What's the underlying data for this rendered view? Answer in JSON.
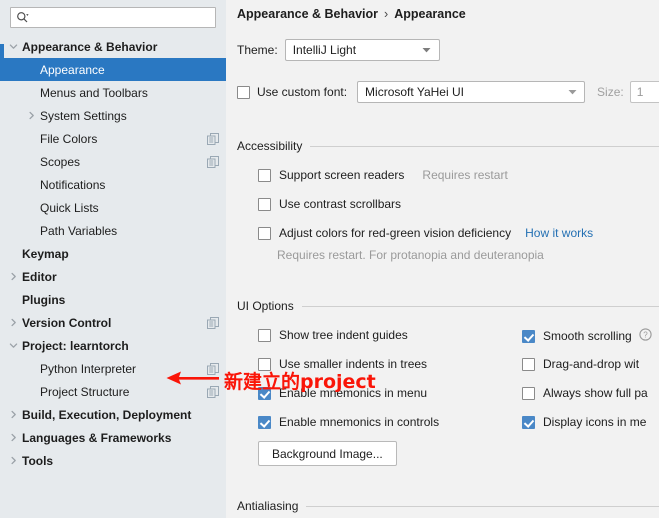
{
  "search": {
    "placeholder": "",
    "value": "",
    "icon": "search-icon"
  },
  "sidebar": {
    "items": [
      {
        "label": "Appearance & Behavior",
        "depth": 0,
        "bold": true,
        "twisty": "chevron-down",
        "selected": false,
        "copy": false
      },
      {
        "label": "Appearance",
        "depth": 1,
        "bold": false,
        "twisty": "none",
        "selected": true,
        "copy": false
      },
      {
        "label": "Menus and Toolbars",
        "depth": 1,
        "bold": false,
        "twisty": "none",
        "selected": false,
        "copy": false
      },
      {
        "label": "System Settings",
        "depth": 1,
        "bold": false,
        "twisty": "chevron-right",
        "selected": false,
        "copy": false
      },
      {
        "label": "File Colors",
        "depth": 1,
        "bold": false,
        "twisty": "none",
        "selected": false,
        "copy": true
      },
      {
        "label": "Scopes",
        "depth": 1,
        "bold": false,
        "twisty": "none",
        "selected": false,
        "copy": true
      },
      {
        "label": "Notifications",
        "depth": 1,
        "bold": false,
        "twisty": "none",
        "selected": false,
        "copy": false
      },
      {
        "label": "Quick Lists",
        "depth": 1,
        "bold": false,
        "twisty": "none",
        "selected": false,
        "copy": false
      },
      {
        "label": "Path Variables",
        "depth": 1,
        "bold": false,
        "twisty": "none",
        "selected": false,
        "copy": false
      },
      {
        "label": "Keymap",
        "depth": 0,
        "bold": true,
        "twisty": "none",
        "selected": false,
        "copy": false
      },
      {
        "label": "Editor",
        "depth": 0,
        "bold": true,
        "twisty": "chevron-right",
        "selected": false,
        "copy": false
      },
      {
        "label": "Plugins",
        "depth": 0,
        "bold": true,
        "twisty": "none",
        "selected": false,
        "copy": false
      },
      {
        "label": "Version Control",
        "depth": 0,
        "bold": true,
        "twisty": "chevron-right",
        "selected": false,
        "copy": true
      },
      {
        "label": "Project: learntorch",
        "depth": 0,
        "bold": true,
        "twisty": "chevron-down",
        "selected": false,
        "copy": false
      },
      {
        "label": "Python Interpreter",
        "depth": 1,
        "bold": false,
        "twisty": "none",
        "selected": false,
        "copy": true
      },
      {
        "label": "Project Structure",
        "depth": 1,
        "bold": false,
        "twisty": "none",
        "selected": false,
        "copy": true
      },
      {
        "label": "Build, Execution, Deployment",
        "depth": 0,
        "bold": true,
        "twisty": "chevron-right",
        "selected": false,
        "copy": false
      },
      {
        "label": "Languages & Frameworks",
        "depth": 0,
        "bold": true,
        "twisty": "chevron-right",
        "selected": false,
        "copy": false
      },
      {
        "label": "Tools",
        "depth": 0,
        "bold": true,
        "twisty": "chevron-right",
        "selected": false,
        "copy": false
      }
    ]
  },
  "breadcrumb": {
    "parent": "Appearance & Behavior",
    "separator": "›",
    "current": "Appearance"
  },
  "theme": {
    "label": "Theme:",
    "value": "IntelliJ Light"
  },
  "custom_font": {
    "checked": false,
    "label": "Use custom font:",
    "value": "Microsoft YaHei UI",
    "size_label": "Size:",
    "size_value": "1"
  },
  "accessibility": {
    "title": "Accessibility",
    "options": [
      {
        "label": "Support screen readers",
        "checked": false,
        "note": "Requires restart",
        "link": ""
      },
      {
        "label": "Use contrast scrollbars",
        "checked": false,
        "note": "",
        "link": ""
      },
      {
        "label": "Adjust colors for red-green vision deficiency",
        "checked": false,
        "note": "",
        "link": "How it works"
      }
    ],
    "footnote": "Requires restart. For protanopia and deuteranopia"
  },
  "ui_options": {
    "title": "UI Options",
    "left_column": [
      {
        "label": "Show tree indent guides",
        "checked": false
      },
      {
        "label": "Use smaller indents in trees",
        "checked": false
      },
      {
        "label": "Enable mnemonics in menu",
        "checked": true
      },
      {
        "label": "Enable mnemonics in controls",
        "checked": true
      }
    ],
    "right_column": [
      {
        "label": "Smooth scrolling",
        "checked": true,
        "help": true
      },
      {
        "label": "Drag-and-drop wit",
        "checked": false,
        "help": false
      },
      {
        "label": "Always show full pa",
        "checked": false,
        "help": false
      },
      {
        "label": "Display icons in me",
        "checked": true,
        "help": false
      }
    ],
    "background_image_button": "Background Image..."
  },
  "antialiasing": {
    "title": "Antialiasing"
  },
  "annotation": {
    "text": "新建立的project",
    "color": "#fa1508"
  },
  "colors": {
    "selection_blue": "#2a78c2",
    "checkbox_blue": "#4a88c7",
    "link_blue": "#2470b3",
    "sidebar_bg": "#e6eaed",
    "content_bg": "#f2f2f2",
    "annotation_red": "#fa1508"
  }
}
